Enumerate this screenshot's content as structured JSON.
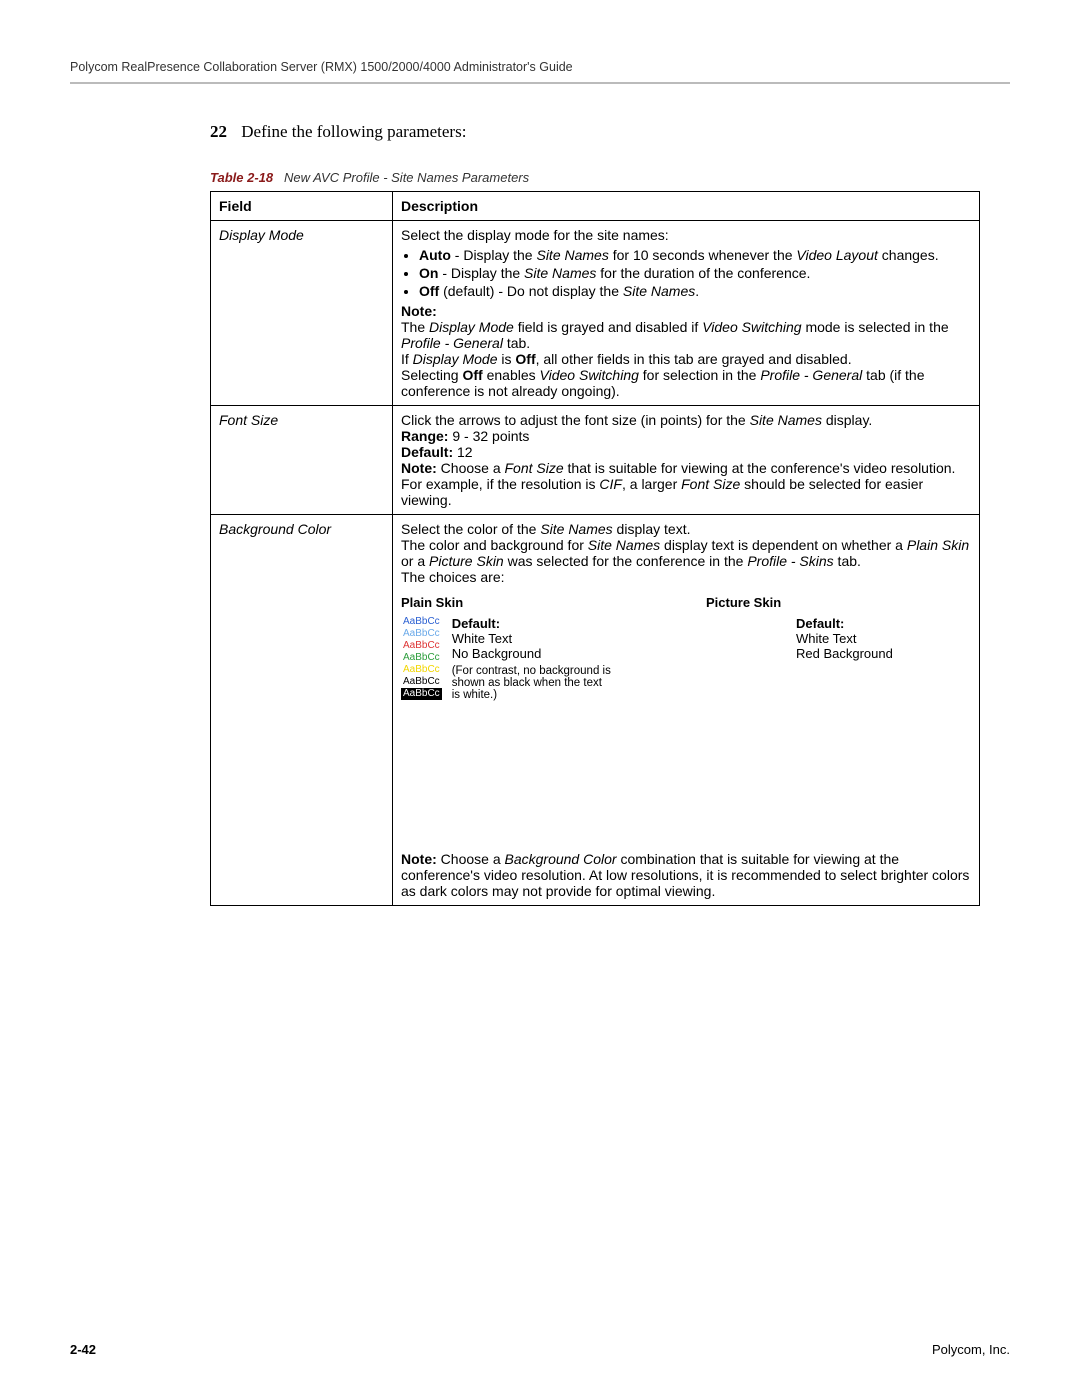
{
  "header": "Polycom RealPresence Collaboration Server (RMX) 1500/2000/4000 Administrator's Guide",
  "step": {
    "num": "22",
    "text": "Define the following parameters:"
  },
  "caption": {
    "label": "Table 2-18",
    "title": "New AVC Profile - Site Names Parameters"
  },
  "table_headers": {
    "field": "Field",
    "desc": "Description"
  },
  "rows": {
    "display_mode": {
      "field": "Display Mode",
      "intro": "Select the display mode for the site names:",
      "b1_a": "Auto",
      "b1_b": " - Display the ",
      "b1_c": "Site Names",
      "b1_d": " for 10 seconds whenever the ",
      "b1_e": "Video Layout",
      "b1_f": " changes.",
      "b2_a": "On",
      "b2_b": " - Display the ",
      "b2_c": "Site Names",
      "b2_d": " for the duration of the conference.",
      "b3_a": "Off",
      "b3_b": " (default) - Do not display the ",
      "b3_c": "Site Names",
      "b3_d": ".",
      "note_label": "Note:",
      "n1_a": "The ",
      "n1_b": "Display Mode",
      "n1_c": " field is grayed and disabled if ",
      "n1_d": "Video Switching",
      "n1_e": " mode is selected in the ",
      "n1_f": "Profile - General",
      "n1_g": " tab.",
      "n2_a": " If ",
      "n2_b": "Display Mode",
      "n2_c": " is ",
      "n2_d": "Off",
      "n2_e": ", all other fields in this tab are grayed and disabled.",
      "n3_a": "Selecting ",
      "n3_b": "Off",
      "n3_c": " enables ",
      "n3_d": "Video Switching",
      "n3_e": " for selection in the ",
      "n3_f": "Profile - General",
      "n3_g": " tab (if the conference is not already ongoing)."
    },
    "font_size": {
      "field": "Font Size",
      "l1_a": "Click the arrows to adjust the font size (in points) for the ",
      "l1_b": "Site Names",
      "l1_c": " display.",
      "range_label": "Range:",
      "range_val": " 9 - 32 points",
      "default_label": "Default:",
      "default_val": " 12",
      "note_label": "Note:",
      "n_a": " Choose a ",
      "n_b": "Font Size",
      "n_c": " that is suitable for viewing at the conference's video resolution. For example, if the resolution is ",
      "n_d": "CIF",
      "n_e": ", a larger ",
      "n_f": "Font Size",
      "n_g": " should be selected for easier viewing."
    },
    "bg": {
      "field": "Background Color",
      "l1_a": "Select the color of the ",
      "l1_b": "Site Names",
      "l1_c": " display text.",
      "l2_a": "The color and background for ",
      "l2_b": "Site Names",
      "l2_c": " display text is dependent on whether a ",
      "l2_d": "Plain Skin",
      "l2_e": " or a ",
      "l2_f": "Picture Skin",
      "l2_g": " was selected for the conference in the ",
      "l2_h": "Profile - Skins",
      "l2_i": " tab.",
      "choices": "The choices are:",
      "plain_title": "Plain Skin",
      "picture_title": "Picture Skin",
      "swatch_text": "AaBbCc",
      "plain_default": "Default:",
      "plain_l1": "White Text",
      "plain_l2": "No Background",
      "plain_note": "(For contrast, no background is shown as black when the text is white.)",
      "pic_default": "Default:",
      "pic_l1": "White Text",
      "pic_l2": "Red Background",
      "note_label": "Note:",
      "note_a": " Choose a ",
      "note_b": "Background Color",
      "note_c": " combination that is suitable for viewing at the conference's video resolution. At low resolutions, it is recommended to select brighter colors as dark colors may not provide for optimal viewing."
    }
  },
  "footer": {
    "page": "2-42",
    "company": "Polycom, Inc."
  }
}
